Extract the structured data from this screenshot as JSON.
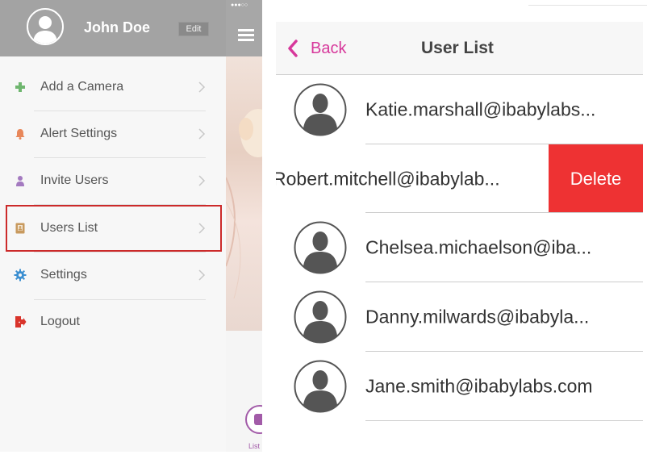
{
  "menu": {
    "user_name": "John Doe",
    "edit_label": "Edit",
    "items": [
      {
        "label": "Add a Camera",
        "icon": "plus-icon",
        "color": "#6fb66f"
      },
      {
        "label": "Alert Settings",
        "icon": "bell-icon",
        "color": "#e8875a"
      },
      {
        "label": "Invite Users",
        "icon": "person-icon",
        "color": "#a47ac0"
      },
      {
        "label": "Users List",
        "icon": "contacts-book-icon",
        "color": "#c89a5e"
      },
      {
        "label": "Settings",
        "icon": "gear-icon",
        "color": "#3b8fd1"
      },
      {
        "label": "Logout",
        "icon": "logout-door-icon",
        "color": "#d9342b"
      }
    ],
    "highlight_color": "#cc2a2a"
  },
  "home_peek": {
    "signal_dots": "●●●○○",
    "list_label": "List",
    "accent": "#a25ba8"
  },
  "user_list": {
    "back_label": "Back",
    "title": "User List",
    "accent": "#d7389b",
    "delete_label": "Delete",
    "delete_color": "#ee3233",
    "users": [
      "Katie.marshall@ibabylabs...",
      "Robert.mitchell@ibabylab...",
      "Chelsea.michaelson@iba...",
      "Danny.milwards@ibabyla...",
      "Jane.smith@ibabylabs.com"
    ]
  }
}
